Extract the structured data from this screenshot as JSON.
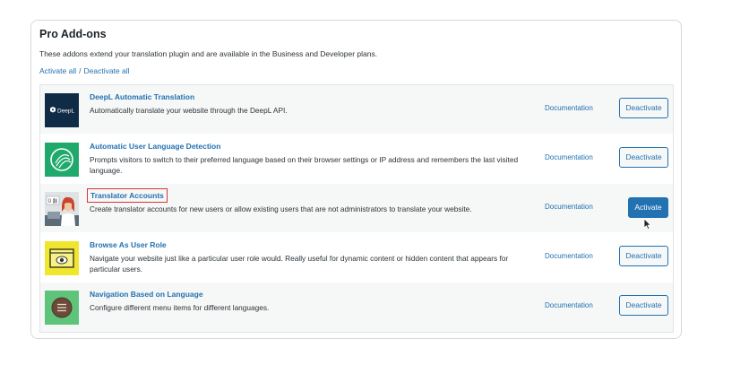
{
  "panel": {
    "title": "Pro Add-ons",
    "description": "These addons extend your translation plugin and are available in the Business and Developer plans.",
    "activate_all": "Activate all",
    "separator": "/",
    "deactivate_all": "Deactivate all"
  },
  "addons": [
    {
      "name": "DeepL Automatic Translation",
      "description": "Automatically translate your website through the DeepL API.",
      "documentation": "Documentation",
      "button": "Deactivate",
      "logo_text": "DeepL",
      "icon": "deepl-logo-icon"
    },
    {
      "name": "Automatic User Language Detection",
      "description": "Prompts visitors to switch to their preferred language based on their browser settings or IP address and remembers the last visited language.",
      "documentation": "Documentation",
      "button": "Deactivate",
      "icon": "language-detection-icon"
    },
    {
      "name": "Translator Accounts",
      "description": "Create translator accounts for new users or allow existing users that are not administrators to translate your website.",
      "documentation": "Documentation",
      "button": "Activate",
      "logo_text": "Ü 翻",
      "icon": "translator-accounts-icon"
    },
    {
      "name": "Browse As User Role",
      "description": "Navigate your website just like a particular user role would. Really useful for dynamic content or hidden content that appears for particular users.",
      "documentation": "Documentation",
      "button": "Deactivate",
      "icon": "browse-as-role-icon"
    },
    {
      "name": "Navigation Based on Language",
      "description": "Configure different menu items for different languages.",
      "documentation": "Documentation",
      "button": "Deactivate",
      "icon": "navigation-menu-icon"
    }
  ],
  "colors": {
    "link": "#2271b1",
    "primary_button": "#2271b1",
    "deepl_bg": "#0f2b46",
    "detection_bg": "#1faa6b",
    "browse_bg": "#f0e62d",
    "navigation_bg": "#5ec47a",
    "highlight_outline": "#d63638"
  }
}
